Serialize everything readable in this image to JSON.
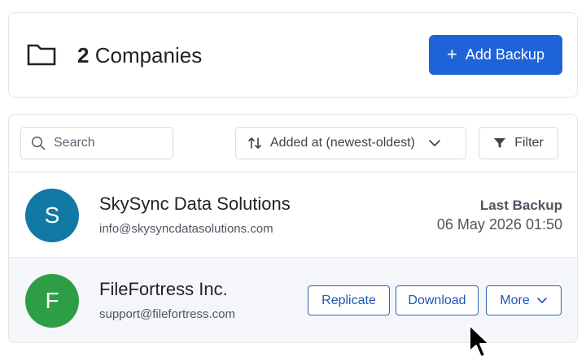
{
  "header": {
    "count": "2",
    "title_suffix": "Companies",
    "add_button_label": "Add Backup",
    "folder_icon": "folder-icon",
    "plus_icon": "plus-icon"
  },
  "toolbar": {
    "search_placeholder": "Search",
    "sort_label": "Added at (newest-oldest)",
    "filter_label": "Filter"
  },
  "companies": [
    {
      "initial": "S",
      "name": "SkySync Data Solutions",
      "email": "info@skysyncdatasolutions.com",
      "avatar_color": "#1278a6",
      "last_backup_label": "Last Backup",
      "last_backup_date": "06 May 2026 01:50"
    },
    {
      "initial": "F",
      "name": "FileFortress Inc.",
      "email": "support@filefortress.com",
      "avatar_color": "#2e9e46",
      "actions": {
        "replicate": "Replicate",
        "download": "Download",
        "more": "More"
      }
    }
  ],
  "colors": {
    "primary": "#1f63d8",
    "outline_button": "#1f56b3",
    "hover_row": "#f4f6f9"
  }
}
